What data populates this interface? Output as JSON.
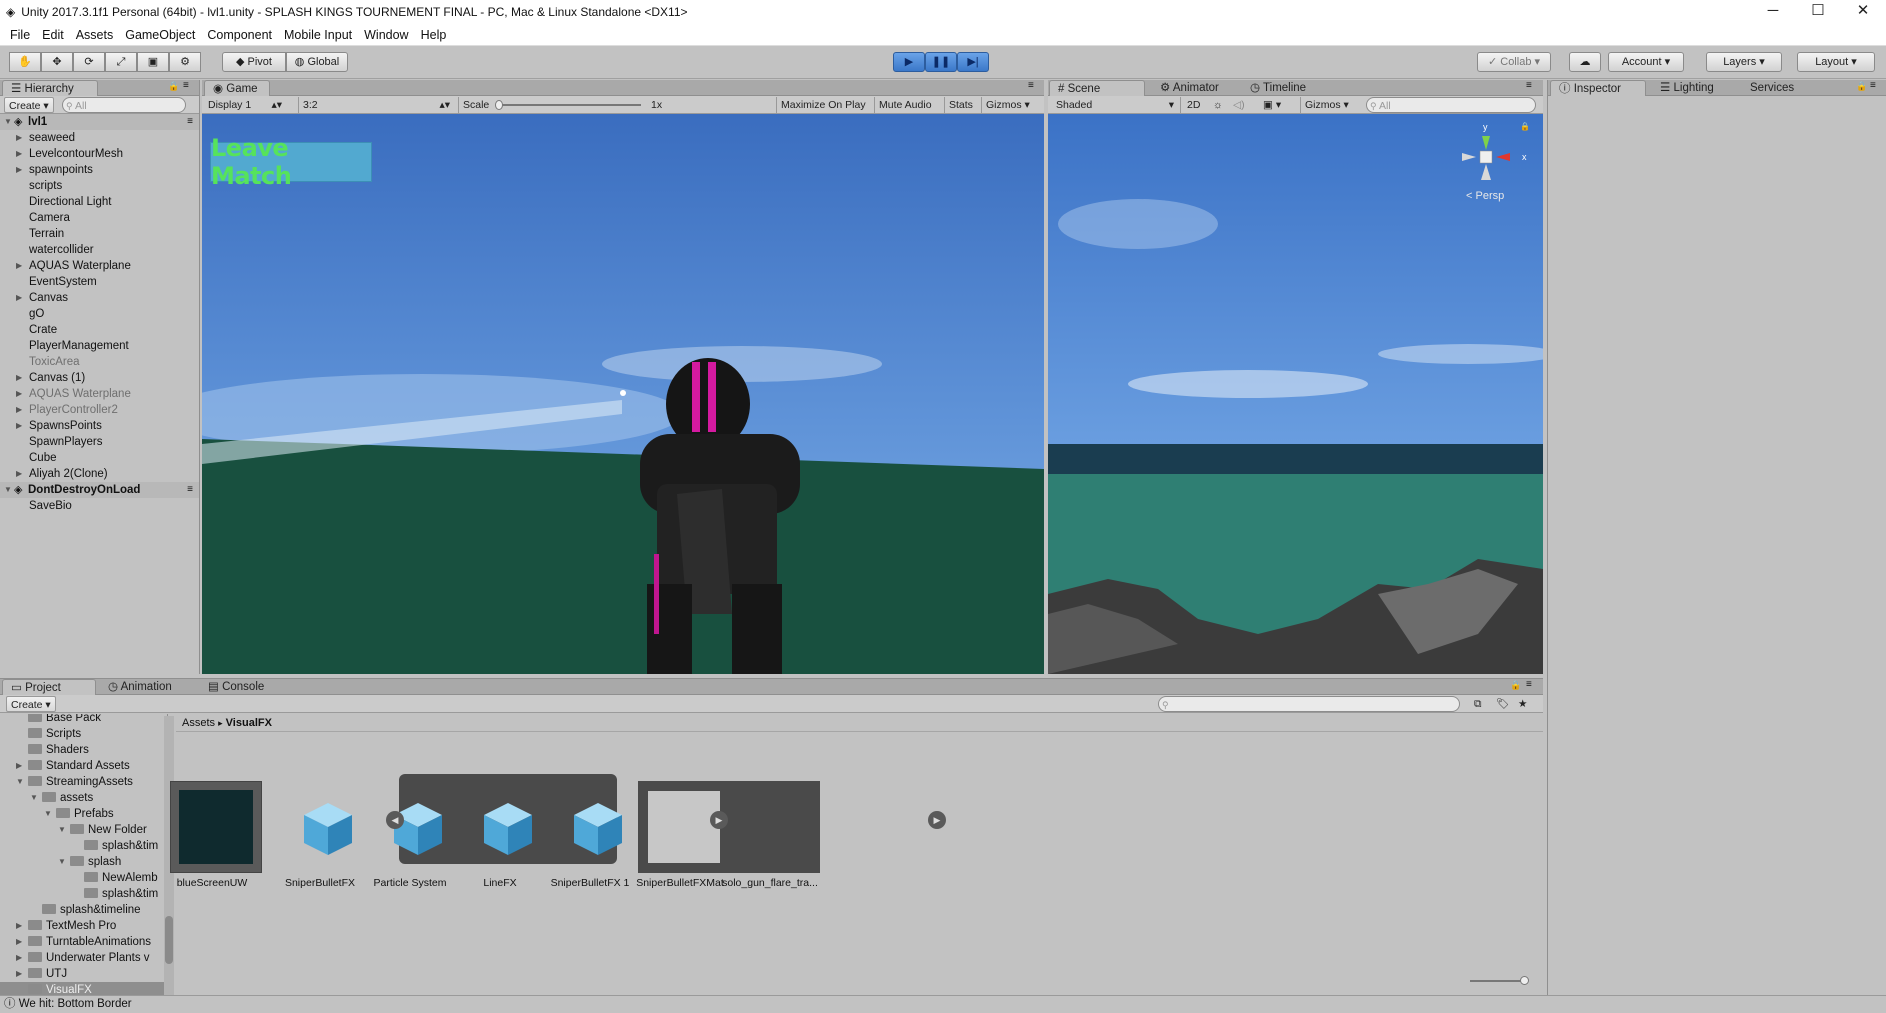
{
  "window": {
    "title": "Unity 2017.3.1f1 Personal (64bit) - lvl1.unity - SPLASH KINGS TOURNEMENT FINAL - PC, Mac & Linux Standalone <DX11>"
  },
  "menu": [
    "File",
    "Edit",
    "Assets",
    "GameObject",
    "Component",
    "Mobile Input",
    "Window",
    "Help"
  ],
  "toolbar": {
    "pivot": "Pivot",
    "global": "Global",
    "collab": "Collab",
    "account": "Account",
    "layers": "Layers",
    "layout": "Layout"
  },
  "hierarchy": {
    "tab": "Hierarchy",
    "create": "Create",
    "search_placeholder": "All",
    "scene": "lvl1",
    "items": [
      {
        "label": "seaweed",
        "arrow": true
      },
      {
        "label": "LevelcontourMesh",
        "arrow": true
      },
      {
        "label": "spawnpoints",
        "arrow": true
      },
      {
        "label": "scripts",
        "arrow": false
      },
      {
        "label": "Directional Light",
        "arrow": false
      },
      {
        "label": "Camera",
        "arrow": false
      },
      {
        "label": "Terrain",
        "arrow": false
      },
      {
        "label": "watercollider",
        "arrow": false
      },
      {
        "label": "AQUAS Waterplane",
        "arrow": true
      },
      {
        "label": "EventSystem",
        "arrow": false
      },
      {
        "label": "Canvas",
        "arrow": true
      },
      {
        "label": "gO",
        "arrow": false
      },
      {
        "label": "Crate",
        "arrow": false
      },
      {
        "label": "PlayerManagement",
        "arrow": false
      },
      {
        "label": "ToxicArea",
        "arrow": false,
        "dim": true
      },
      {
        "label": "Canvas (1)",
        "arrow": true
      },
      {
        "label": "AQUAS Waterplane",
        "arrow": true,
        "dim": true
      },
      {
        "label": "PlayerController2",
        "arrow": true,
        "dim": true
      },
      {
        "label": "SpawnsPoints",
        "arrow": true
      },
      {
        "label": "SpawnPlayers",
        "arrow": false
      },
      {
        "label": "Cube",
        "arrow": false
      },
      {
        "label": "Aliyah 2(Clone)",
        "arrow": true
      }
    ],
    "scene2": "DontDestroyOnLoad",
    "items2": [
      {
        "label": "SaveBio",
        "arrow": false
      }
    ]
  },
  "game": {
    "tab": "Game",
    "display": "Display 1",
    "aspect": "3:2",
    "scale_label": "Scale",
    "scale_value": "1x",
    "maximize": "Maximize On Play",
    "mute": "Mute Audio",
    "stats": "Stats",
    "gizmos": "Gizmos",
    "leave_button": "Leave Match"
  },
  "scene": {
    "tab": "Scene",
    "animator_tab": "Animator",
    "timeline_tab": "Timeline",
    "shaded": "Shaded",
    "mode2d": "2D",
    "gizmos": "Gizmos",
    "search_placeholder": "All",
    "persp": "Persp",
    "axis_y": "y",
    "axis_x": "x"
  },
  "inspector": {
    "tab": "Inspector",
    "lighting_tab": "Lighting",
    "services_tab": "Services"
  },
  "project": {
    "tab": "Project",
    "animation_tab": "Animation",
    "console_tab": "Console",
    "create": "Create",
    "breadcrumb": [
      "Assets",
      "VisualFX"
    ],
    "tree": [
      {
        "label": "Base Pack",
        "indent": 2
      },
      {
        "label": "Scripts",
        "indent": 2
      },
      {
        "label": "Shaders",
        "indent": 2
      },
      {
        "label": "Standard Assets",
        "indent": 2,
        "arrow": "right"
      },
      {
        "label": "StreamingAssets",
        "indent": 2,
        "arrow": "down"
      },
      {
        "label": "assets",
        "indent": 3,
        "arrow": "down"
      },
      {
        "label": "Prefabs",
        "indent": 4,
        "arrow": "down"
      },
      {
        "label": "New Folder",
        "indent": 5,
        "arrow": "down"
      },
      {
        "label": "splash&tim",
        "indent": 6
      },
      {
        "label": "splash",
        "indent": 5,
        "arrow": "down"
      },
      {
        "label": "NewAlemb",
        "indent": 6
      },
      {
        "label": "splash&tim",
        "indent": 6
      },
      {
        "label": "splash&timeline",
        "indent": 3
      },
      {
        "label": "TextMesh Pro",
        "indent": 2,
        "arrow": "right"
      },
      {
        "label": "TurntableAnimations",
        "indent": 2,
        "arrow": "right"
      },
      {
        "label": "Underwater Plants v",
        "indent": 2,
        "arrow": "right"
      },
      {
        "label": "UTJ",
        "indent": 2,
        "arrow": "right"
      },
      {
        "label": "VisualFX",
        "indent": 2,
        "selected": true
      }
    ],
    "assets": [
      {
        "label": "blueScreenUW",
        "kind": "dark"
      },
      {
        "label": "SniperBulletFX",
        "kind": "cube"
      },
      {
        "label": "Particle System",
        "kind": "cube"
      },
      {
        "label": "LineFX",
        "kind": "cube"
      },
      {
        "label": "SniperBulletFX 1",
        "kind": "cube"
      },
      {
        "label": "SniperBulletFXMat",
        "kind": "mat"
      },
      {
        "label": "solo_gun_flare_tra...",
        "kind": "gray"
      }
    ]
  },
  "status": "We hit: Bottom Border"
}
